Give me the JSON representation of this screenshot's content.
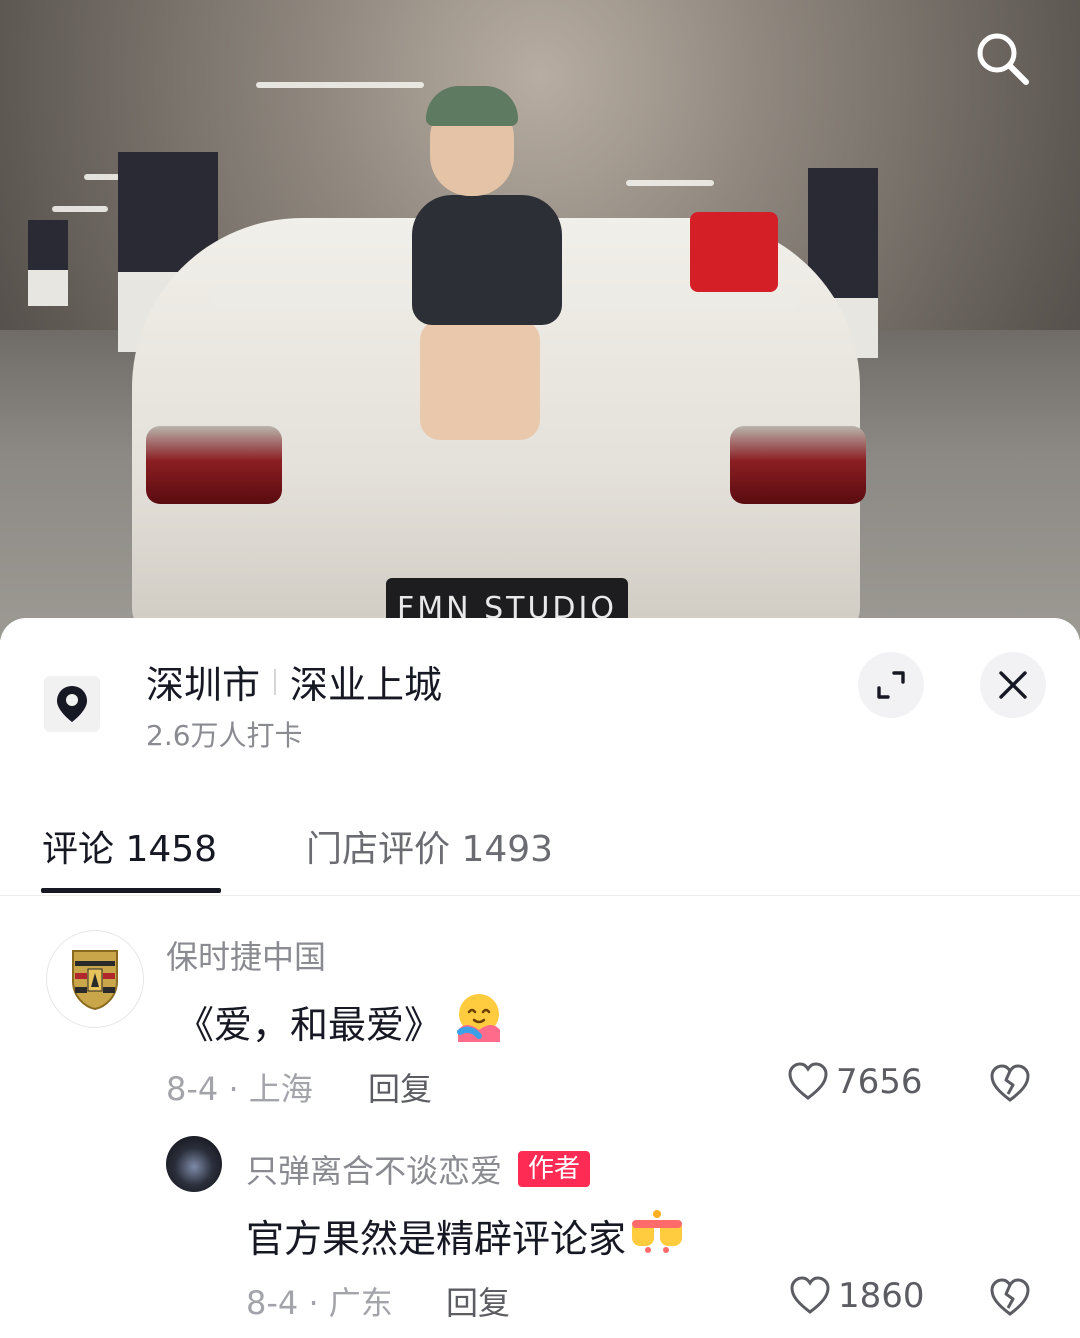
{
  "video": {
    "plate_text": "FMN STUDIO"
  },
  "location": {
    "city": "深圳市",
    "place": "深业上城",
    "checkins": "2.6万人打卡"
  },
  "tabs": [
    {
      "label": "评论 1458",
      "active": true
    },
    {
      "label": "门店评价 1493",
      "active": false
    }
  ],
  "comments": [
    {
      "username": "保时捷中国",
      "text": "《爱，和最爱》",
      "emoji": "hug-emoji",
      "date_location": "8-4 · 上海",
      "reply_label": "回复",
      "likes": "7656"
    }
  ],
  "reply": {
    "username": "只弹离合不谈恋爱",
    "badge": "作者",
    "text": "官方果然是精辟评论家",
    "emoji": "fist-bump-emoji",
    "date_location": "8-4 · 广东",
    "reply_label": "回复",
    "likes": "1860"
  },
  "colors": {
    "accent": "#fe2c55",
    "text_primary": "#161823",
    "text_secondary": "#8a8b91"
  }
}
